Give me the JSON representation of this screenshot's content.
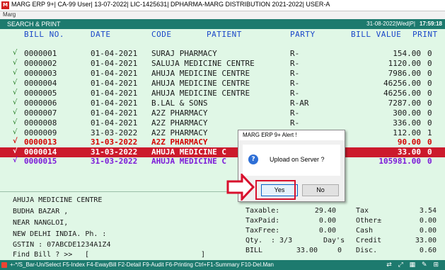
{
  "window": {
    "title": "MARG ERP 9+| CA-99 User| 13-07-2022| LIC-1425631| DPHARMA-MARG DISTRIBUTION 2021-2022| USER-A"
  },
  "menubar": {
    "label": "Marg"
  },
  "topbar": {
    "section": "SEARCH & PRINT",
    "date": "31-08-2022|Wed|P|",
    "time": "17:59:18"
  },
  "table": {
    "headers": {
      "bill_no": "BILL NO.",
      "date": "DATE",
      "code": "CODE",
      "patient": "PATIENT",
      "party": "PARTY",
      "bill_value": "BILL VALUE",
      "print": "PRINT"
    },
    "rows": [
      {
        "mark": "√",
        "bill_no": "0000001",
        "date": "01-04-2021",
        "patient": "SURAJ PHARMACY",
        "party": "R-",
        "value": "154.00",
        "print": "0"
      },
      {
        "mark": "√",
        "bill_no": "0000002",
        "date": "01-04-2021",
        "patient": "SALUJA MEDICINE CENTRE",
        "party": "R-",
        "value": "1120.00",
        "print": "0"
      },
      {
        "mark": "√",
        "bill_no": "0000003",
        "date": "01-04-2021",
        "patient": "AHUJA MEDICINE CENTRE",
        "party": "R-",
        "value": "7986.00",
        "print": "0"
      },
      {
        "mark": "√",
        "bill_no": "0000004",
        "date": "01-04-2021",
        "patient": "AHUJA MEDICINE CENTRE",
        "party": "R-",
        "value": "46256.00",
        "print": "0"
      },
      {
        "mark": "√",
        "bill_no": "0000005",
        "date": "01-04-2021",
        "patient": "AHUJA MEDICINE CENTRE",
        "party": "R-",
        "value": "46256.00",
        "print": "0"
      },
      {
        "mark": "√",
        "bill_no": "0000006",
        "date": "01-04-2021",
        "patient": "B.LAL & SONS",
        "party": "R-AR",
        "value": "7287.00",
        "print": "0"
      },
      {
        "mark": "√",
        "bill_no": "0000007",
        "date": "01-04-2021",
        "patient": "A2Z PHARMACY",
        "party": "R-",
        "value": "300.00",
        "print": "0"
      },
      {
        "mark": "√",
        "bill_no": "0000008",
        "date": "01-04-2021",
        "patient": "A2Z PHARMACY",
        "party": "R-",
        "value": "336.00",
        "print": "0"
      },
      {
        "mark": "√",
        "bill_no": "0000009",
        "date": "31-03-2022",
        "patient": "A2Z PHARMACY",
        "party": "R-",
        "value": "112.00",
        "print": "1"
      },
      {
        "mark": "√",
        "bill_no": "0000013",
        "date": "31-03-2022",
        "patient": "A2Z PHARMACY",
        "party": "",
        "value": "90.00",
        "print": "0"
      },
      {
        "mark": "√",
        "bill_no": "0000014",
        "date": "31-03-2022",
        "patient": "AHUJA MEDICINE C",
        "party": "",
        "value": "33.00",
        "print": "0"
      },
      {
        "mark": "√",
        "bill_no": "0000015",
        "date": "31-03-2022",
        "patient": "AHUJA MEDICINE C",
        "party": "",
        "value": "105981.00",
        "print": "0"
      }
    ]
  },
  "customer": {
    "name": "AHUJA MEDICINE CENTRE",
    "addr1": "BUDHA BAZAR ,",
    "addr2": "NEAR NANGLOI,",
    "addr3": "NEW DELHI INDIA. Ph. :",
    "gstin": "GSTIN : 07ABCDE1234A1Z4",
    "find_label": "Find Bill ? >>",
    "find_open": "[",
    "find_close": "]"
  },
  "summary": {
    "taxable_label": "Taxable:",
    "taxable": "29.40",
    "taxpaid_label": "TaxPaid:",
    "taxpaid": "0.00",
    "taxfree_label": "TaxFree:",
    "taxfree": "0.00",
    "qty_label": "Qty.",
    "qty": ": 3/3",
    "days_label": "Day's",
    "bill_label": "BILL",
    "bill": "33.00",
    "bill_count": "0",
    "tax_label": "Tax",
    "tax": "3.54",
    "other_label": "Other±",
    "other": "0.00",
    "cash_label": "Cash",
    "cash": "0.00",
    "credit_label": "Credit",
    "credit": "33.00",
    "disc_label": "Disc.",
    "disc": "0.60"
  },
  "statusbar": {
    "text": "+-*/S_Bar-Un/Select F5-Index F4-EwayBill F2-Detail F9-Audit F6-Printing Ctrl+F1-Summary F10-Del.Man",
    "icons": "⇄ ⤢ ▦ ✎ ⊞"
  },
  "dialog": {
    "title": "MARG ERP 9+ Alert !",
    "message": "Upload on Server ?",
    "yes": "Yes",
    "no": "No"
  },
  "colors": {
    "teal": "#1d7a6e",
    "green_bg": "#e0f7e6",
    "header_blue": "#1a47c9",
    "red": "#d40000",
    "selected_red": "#cc1a2c",
    "purple": "#7b19d8",
    "highlight": "#d8102d"
  }
}
